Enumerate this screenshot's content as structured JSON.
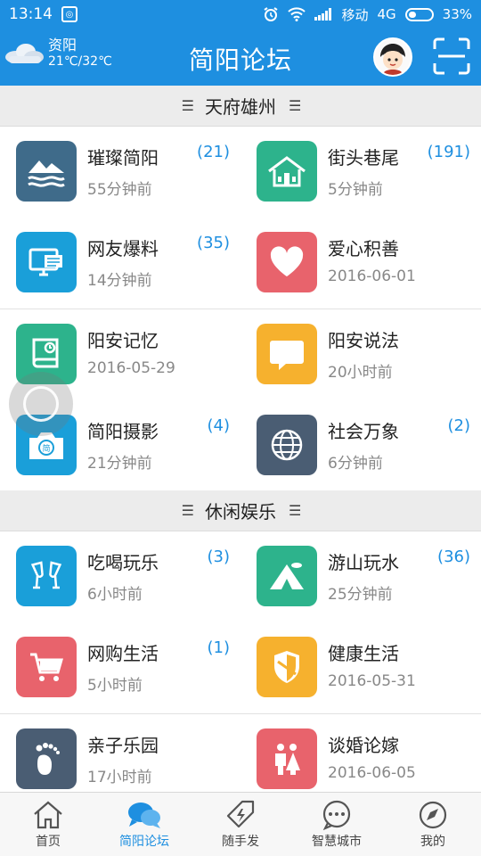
{
  "status_bar": {
    "time": "13:14",
    "carrier": "移动",
    "network": "4G",
    "battery": "33%",
    "battery_level": 0.33
  },
  "header": {
    "city": "资阳",
    "temperature": "21℃/32℃",
    "title": "简阳论坛",
    "weather_icon": "cloud-icon",
    "avatar_icon": "avatar-icon",
    "scan_icon": "scan-icon"
  },
  "sections": [
    {
      "title": "天府雄州",
      "items": [
        {
          "name": "璀璨简阳",
          "time": "55分钟前",
          "count": "(21)",
          "icon": "mountain-wave-icon",
          "color": "#3f6b8a"
        },
        {
          "name": "街头巷尾",
          "time": "5分钟前",
          "count": "(191)",
          "icon": "house-icon",
          "color": "#2db38c"
        },
        {
          "name": "网友爆料",
          "time": "14分钟前",
          "count": "(35)",
          "icon": "computer-icon",
          "color": "#1a9fd9"
        },
        {
          "name": "爱心积善",
          "time": "2016-06-01",
          "count": "",
          "icon": "heart-icon",
          "color": "#e8636c"
        },
        {
          "name": "阳安记忆",
          "time": "2016-05-29",
          "count": "",
          "icon": "book-icon",
          "color": "#2db38c"
        },
        {
          "name": "阳安说法",
          "time": "20小时前",
          "count": "",
          "icon": "speech-bubble-icon",
          "color": "#f6b12e"
        },
        {
          "name": "简阳摄影",
          "time": "21分钟前",
          "count": "(4)",
          "icon": "camera-icon",
          "color": "#1a9fd9"
        },
        {
          "name": "社会万象",
          "time": "6分钟前",
          "count": "(2)",
          "icon": "globe-icon",
          "color": "#4a5d73"
        }
      ]
    },
    {
      "title": "休闲娱乐",
      "items": [
        {
          "name": "吃喝玩乐",
          "time": "6小时前",
          "count": "(3)",
          "icon": "wine-glasses-icon",
          "color": "#1a9fd9"
        },
        {
          "name": "游山玩水",
          "time": "25分钟前",
          "count": "(36)",
          "icon": "tent-icon",
          "color": "#2db38c"
        },
        {
          "name": "网购生活",
          "time": "5小时前",
          "count": "(1)",
          "icon": "shopping-cart-icon",
          "color": "#e8636c"
        },
        {
          "name": "健康生活",
          "time": "2016-05-31",
          "count": "",
          "icon": "shield-icon",
          "color": "#f6b12e"
        },
        {
          "name": "亲子乐园",
          "time": "17小时前",
          "count": "",
          "icon": "footprint-icon",
          "color": "#4a5d73"
        },
        {
          "name": "谈婚论嫁",
          "time": "2016-06-05",
          "count": "",
          "icon": "couple-icon",
          "color": "#e8636c"
        }
      ]
    }
  ],
  "tabs": [
    {
      "label": "首页",
      "icon": "home-icon",
      "active": false
    },
    {
      "label": "简阳论坛",
      "icon": "chat-bubbles-icon",
      "active": true
    },
    {
      "label": "随手发",
      "icon": "lightning-tag-icon",
      "active": false
    },
    {
      "label": "智慧城市",
      "icon": "chat-dots-icon",
      "active": false
    },
    {
      "label": "我的",
      "icon": "compass-icon",
      "active": false
    }
  ],
  "colors": {
    "accent": "#1e8fe0",
    "section_bg": "#ececec",
    "count": "#1e8fe0"
  }
}
